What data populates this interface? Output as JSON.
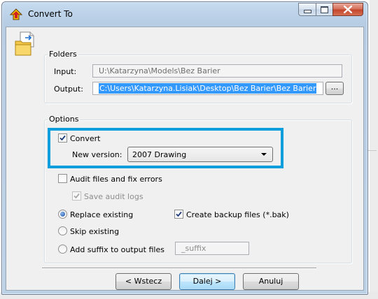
{
  "window": {
    "title": "Convert To",
    "minimize_icon": "minimize-icon",
    "maximize_icon": "maximize-icon",
    "close_icon": "close-icon"
  },
  "folders": {
    "legend": "Folders",
    "input_label": "Input:",
    "input_value": "U:\\Katarzyna\\Models\\Bez Barier",
    "output_label": "Output:",
    "output_value": "C:\\Users\\Katarzyna.Lisiak\\Desktop\\Bez Barier\\Bez Barier",
    "browse_label": "..."
  },
  "options": {
    "legend": "Options",
    "convert_label": "Convert",
    "convert_checked": true,
    "new_version_label": "New version:",
    "new_version_value": "2007 Drawing",
    "audit_label": "Audit files and fix errors",
    "audit_checked": false,
    "save_audit_label": "Save audit logs",
    "save_audit_checked": true,
    "replace_label": "Replace existing",
    "backup_label": "Create backup files (*.bak)",
    "backup_checked": true,
    "skip_label": "Skip existing",
    "suffix_label": "Add suffix to output files",
    "suffix_placeholder": "_suffix",
    "selected_mode": "replace"
  },
  "buttons": {
    "back": "< Wstecz",
    "next": "Dalej >",
    "cancel": "Anuluj"
  },
  "colors": {
    "highlight_border": "#0a9fdc",
    "selection": "#3399ff",
    "close_button": "#c2432a"
  }
}
